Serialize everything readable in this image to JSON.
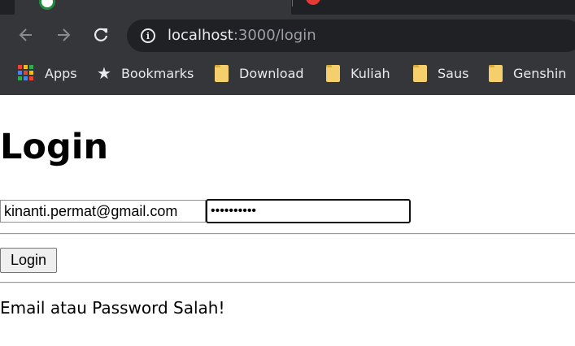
{
  "browser": {
    "url_host": "localhost",
    "url_path": ":3000/login",
    "bookmarks": [
      {
        "label": "Apps",
        "icon": "apps-grid-icon"
      },
      {
        "label": "Bookmarks",
        "icon": "star-icon"
      },
      {
        "label": "Download",
        "icon": "folder-icon"
      },
      {
        "label": "Kuliah",
        "icon": "folder-icon"
      },
      {
        "label": "Saus",
        "icon": "folder-icon"
      },
      {
        "label": "Genshin",
        "icon": "folder-icon"
      }
    ],
    "colors": {
      "toolbar": "#35363a",
      "tabstrip": "#202124",
      "omnibox": "#202124",
      "folder": "#f4cf6b"
    }
  },
  "page": {
    "title": "Login",
    "form": {
      "email_value": "kinanti.permat@gmail.com",
      "password_value": "••••••••••",
      "submit_label": "Login"
    },
    "error_message": "Email atau Password Salah!"
  }
}
